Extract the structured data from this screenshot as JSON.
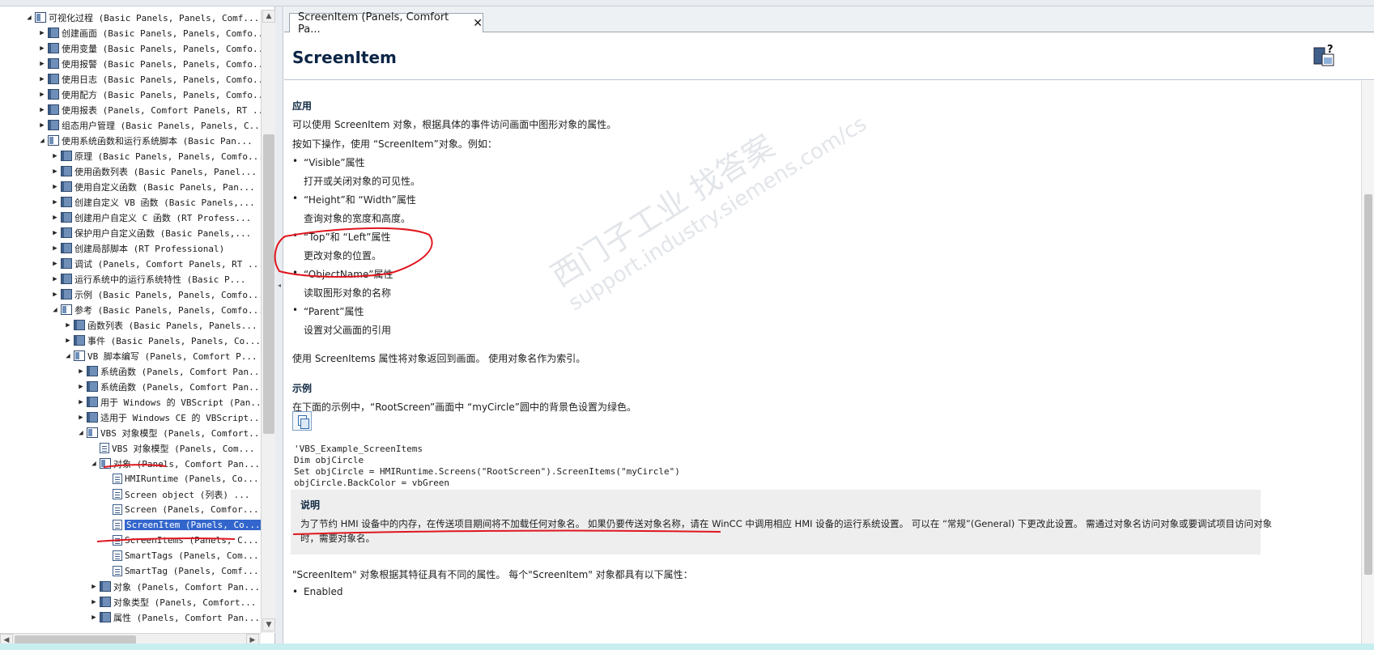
{
  "tree": {
    "items": [
      {
        "label": "可视化过程 (Basic Panels, Panels, Comf...",
        "state": "expanded",
        "icon": "open-book-icon",
        "indent": 0
      },
      {
        "label": "创建画面 (Basic Panels, Panels, Comfo...",
        "state": "collapsed",
        "icon": "book-icon",
        "indent": 1
      },
      {
        "label": "使用变量 (Basic Panels, Panels, Comfo...",
        "state": "collapsed",
        "icon": "book-icon",
        "indent": 1
      },
      {
        "label": "使用报警 (Basic Panels, Panels, Comfo...",
        "state": "collapsed",
        "icon": "book-icon",
        "indent": 1
      },
      {
        "label": "使用日志 (Basic Panels, Panels, Comfo...",
        "state": "collapsed",
        "icon": "book-icon",
        "indent": 1
      },
      {
        "label": "使用配方 (Basic Panels, Panels, Comfo...",
        "state": "collapsed",
        "icon": "book-icon",
        "indent": 1
      },
      {
        "label": "使用报表 (Panels, Comfort Panels, RT ...",
        "state": "collapsed",
        "icon": "book-icon",
        "indent": 1
      },
      {
        "label": "组态用户管理 (Basic Panels, Panels, C...",
        "state": "collapsed",
        "icon": "book-icon",
        "indent": 1
      },
      {
        "label": "使用系统函数和运行系统脚本 (Basic Pan...",
        "state": "expanded",
        "icon": "open-book-icon",
        "indent": 1
      },
      {
        "label": "原理 (Basic Panels, Panels, Comfo...",
        "state": "collapsed",
        "icon": "book-icon",
        "indent": 2
      },
      {
        "label": "使用函数列表 (Basic Panels, Panel...",
        "state": "collapsed",
        "icon": "book-icon",
        "indent": 2
      },
      {
        "label": "使用自定义函数 (Basic Panels, Pan...",
        "state": "collapsed",
        "icon": "book-icon",
        "indent": 2
      },
      {
        "label": "创建自定义 VB 函数 (Basic Panels,...",
        "state": "collapsed",
        "icon": "book-icon",
        "indent": 2
      },
      {
        "label": "创建用户自定义 C 函数 (RT Profess...",
        "state": "collapsed",
        "icon": "book-icon",
        "indent": 2
      },
      {
        "label": "保护用户自定义函数 (Basic Panels,...",
        "state": "collapsed",
        "icon": "book-icon",
        "indent": 2
      },
      {
        "label": "创建局部脚本 (RT Professional)",
        "state": "collapsed",
        "icon": "book-icon",
        "indent": 2
      },
      {
        "label": "调试 (Panels, Comfort Panels, RT ...",
        "state": "collapsed",
        "icon": "book-icon",
        "indent": 2
      },
      {
        "label": "运行系统中的运行系统特性 (Basic P...",
        "state": "collapsed",
        "icon": "book-icon",
        "indent": 2
      },
      {
        "label": "示例 (Basic Panels, Panels, Comfo...",
        "state": "collapsed",
        "icon": "book-icon",
        "indent": 2
      },
      {
        "label": "参考 (Basic Panels, Panels, Comfo...",
        "state": "expanded",
        "icon": "open-book-icon",
        "indent": 2
      },
      {
        "label": "函数列表 (Basic Panels, Panels...",
        "state": "collapsed",
        "icon": "book-icon",
        "indent": 3
      },
      {
        "label": "事件 (Basic Panels, Panels, Co...",
        "state": "collapsed",
        "icon": "book-icon",
        "indent": 3
      },
      {
        "label": "VB 脚本编写 (Panels, Comfort P...",
        "state": "expanded",
        "icon": "open-book-icon",
        "indent": 3
      },
      {
        "label": "系统函数 (Panels, Comfort Pan...",
        "state": "collapsed",
        "icon": "book-icon",
        "indent": 4
      },
      {
        "label": "系统函数 (Panels, Comfort Pan...",
        "state": "collapsed",
        "icon": "book-icon",
        "indent": 4
      },
      {
        "label": "用于 Windows 的 VBScript (Pan...",
        "state": "collapsed",
        "icon": "book-icon",
        "indent": 4
      },
      {
        "label": "适用于 Windows CE 的 VBScript...",
        "state": "collapsed",
        "icon": "book-icon",
        "indent": 4
      },
      {
        "label": "VBS 对象模型 (Panels, Comfort...",
        "state": "expanded",
        "icon": "open-book-icon",
        "indent": 4
      },
      {
        "label": "VBS 对象模型 (Panels, Com...",
        "state": "leaf",
        "icon": "page-icon",
        "indent": 5
      },
      {
        "label": "对象 (Panels, Comfort Pan...",
        "state": "expanded",
        "icon": "open-book-icon",
        "indent": 5
      },
      {
        "label": "HMIRuntime (Panels, Co...",
        "state": "leaf",
        "icon": "page-icon",
        "indent": 6
      },
      {
        "label": "Screen object (列表) ...",
        "state": "leaf",
        "icon": "page-icon",
        "indent": 6
      },
      {
        "label": "Screen (Panels, Comfor...",
        "state": "leaf",
        "icon": "page-icon",
        "indent": 6
      },
      {
        "label": "ScreenItem (Panels, Co...",
        "state": "leaf",
        "icon": "page-icon",
        "indent": 6,
        "selected": true
      },
      {
        "label": "ScreenItems (Panels, C...",
        "state": "leaf",
        "icon": "page-icon",
        "indent": 6
      },
      {
        "label": "SmartTags (Panels, Com...",
        "state": "leaf",
        "icon": "page-icon",
        "indent": 6
      },
      {
        "label": "SmartTag (Panels, Comf...",
        "state": "leaf",
        "icon": "page-icon",
        "indent": 6
      },
      {
        "label": "对象 (Panels, Comfort Pan...",
        "state": "collapsed",
        "icon": "book-icon",
        "indent": 5
      },
      {
        "label": "对象类型 (Panels, Comfort...",
        "state": "collapsed",
        "icon": "book-icon",
        "indent": 5
      },
      {
        "label": "属性 (Panels, Comfort Pan...",
        "state": "collapsed",
        "icon": "book-icon",
        "indent": 5
      }
    ]
  },
  "tab": {
    "label": "ScreenItem (Panels, Comfort Pa...",
    "close": "✕"
  },
  "page": {
    "title": "ScreenItem",
    "sec_app": "应用",
    "intro1": "可以使用 ScreenItem 对象，根据具体的事件访问画面中图形对象的属性。",
    "intro2": "按如下操作，使用 “ScreenItem”对象。例如：",
    "b1": "“Visible”属性",
    "b1d": "打开或关闭对象的可见性。",
    "b2": "“Height”和 “Width”属性",
    "b2d": "查询对象的宽度和高度。",
    "b3": "“Top”和 “Left”属性",
    "b3d": "更改对象的位置。",
    "b4": "“ObjectName”属性",
    "b4d": "读取图形对象的名称",
    "b5": "“Parent”属性",
    "b5d": "设置对父画面的引用",
    "para": "使用 ScreenItems 属性将对象返回到画面。 使用对象名作为索引。",
    "sec_example": "示例",
    "example_intro": "在下面的示例中，“RootScreen”画面中 “myCircle”圆中的背景色设置为绿色。",
    "code": [
      "'VBS_Example_ScreenItems",
      "Dim objCircle",
      "Set objCircle = HMIRuntime.Screens(\"RootScreen\").ScreenItems(\"myCircle\")",
      "objCircle.BackColor = vbGreen"
    ],
    "note_title": "说明",
    "note_line1": "为了节约 HMI 设备中的内存，在传送项目期间将不加载任何对象名。 如果仍要传送对象名称，请在 WinCC 中调用相应 HMI 设备的运行系统设置。 可以在 “常规”(General) 下更改此设置。 需通过对象名访问对象或要调试项目访问对象",
    "note_line2": "时，需要对象名。",
    "para2": "\"ScreenItem\" 对象根据其特征具有不同的属性。 每个\"ScreenItem\" 对象都具有以下属性：",
    "b6": "Enabled"
  },
  "watermark": {
    "line1": "西门子工业   找答案",
    "line2": "support.industry.siemens.com/cs"
  },
  "colors": {
    "selection": "#3366cc",
    "title": "#0b2545",
    "annotation_red": "#e0161e"
  }
}
